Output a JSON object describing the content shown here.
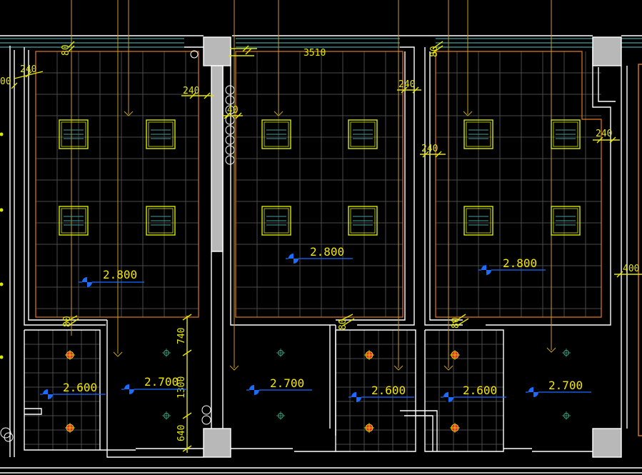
{
  "colors": {
    "background": "#000000",
    "wall": "#ffffff",
    "ceiling_outline": "#e07a20",
    "grid": "#4a4a4a",
    "dimension": "#e6e600",
    "leader": "#c8a020",
    "elevation_marker": "#1a6cff",
    "light_fixture": "#d8e800",
    "downlight": "#e03030",
    "window": "#40a0a0",
    "column": "#b8b8b8"
  },
  "rooms": [
    {
      "id": "room-1",
      "ceiling_height": "2.800",
      "fixture_count": 4
    },
    {
      "id": "room-2",
      "ceiling_height": "2.800",
      "fixture_count": 4
    },
    {
      "id": "room-3",
      "ceiling_height": "2.800",
      "fixture_count": 4
    }
  ],
  "bathrooms": [
    {
      "id": "bath-1",
      "ceiling_height": "2.600"
    },
    {
      "id": "bath-2",
      "ceiling_height": "2.600"
    },
    {
      "id": "bath-3",
      "ceiling_height": "2.600"
    }
  ],
  "corridors": [
    {
      "id": "corridor-1",
      "ceiling_height": "2.700"
    },
    {
      "id": "corridor-2",
      "ceiling_height": "2.700"
    },
    {
      "id": "corridor-3",
      "ceiling_height": "2.700"
    }
  ],
  "dimensions": {
    "top_width": "3510",
    "offset_a": "240",
    "offset_b": "240",
    "offset_c": "240",
    "offset_d": "240",
    "offset_e": "240",
    "offset_f": "240",
    "small_a": "80",
    "small_b": "80",
    "small_c": "80",
    "small_d": "80",
    "small_e": "80",
    "v_740": "740",
    "v_1300": "1300",
    "v_640": "640",
    "left_edge": "00",
    "right_edge": "400",
    "mid_40": "40"
  }
}
